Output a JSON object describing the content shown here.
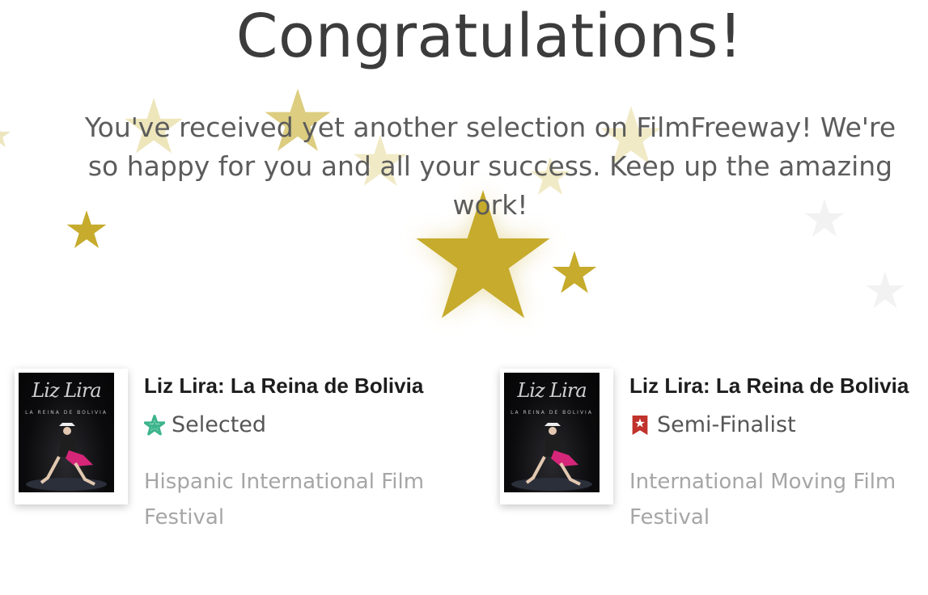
{
  "header": {
    "title": "Congratulations!",
    "message": "You've received yet another selection on FilmFreeway! We're so happy for you and all your success. Keep up the amazing work!"
  },
  "colors": {
    "star_gold": "#c6ab2c",
    "star_pale": "#ece2ad",
    "star_gray": "#f1f1f1",
    "selected_green": "#3cb48c",
    "semifinalist_red": "#c0322b"
  },
  "selections": [
    {
      "film_title": "Liz Lira: La Reina de Bolivia",
      "status": "Selected",
      "status_icon": "star-badge-icon",
      "festival": "Hispanic International Film Festival",
      "poster": {
        "title": "Liz Lira",
        "subtitle": "LA REINA DE BOLIVIA"
      }
    },
    {
      "film_title": "Liz Lira: La Reina de Bolivia",
      "status": "Semi-Finalist",
      "status_icon": "ribbon-star-icon",
      "festival": "International Moving Film Festival",
      "poster": {
        "title": "Liz Lira",
        "subtitle": "LA REINA DE BOLIVIA"
      }
    }
  ]
}
